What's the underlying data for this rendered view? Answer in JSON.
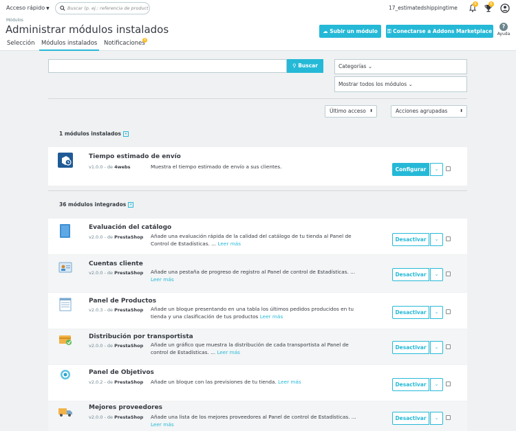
{
  "topbar": {
    "quick_access": "Acceso rápido",
    "search_placeholder": "Buscar (p. ej.: referencia de producto, no",
    "shop_name": "17_estimatedshippingtime",
    "notif_count": "6",
    "trophy_count": "6"
  },
  "header": {
    "breadcrumb": "Módulos",
    "title": "Administrar módulos instalados",
    "upload_label": "Subir un módulo",
    "addons_label": "Conectarse a Addons Marketplace",
    "help_label": "Ayuda",
    "tabs": [
      {
        "label": "Selección"
      },
      {
        "label": "Módulos instalados"
      },
      {
        "label": "Notificaciones",
        "badge": "8"
      }
    ]
  },
  "filters": {
    "search_button": "Buscar",
    "categories": "Categorías",
    "show_all": "Mostrar todos los módulos",
    "sort": "Último acceso",
    "bulk": "Acciones agrupadas"
  },
  "installed": {
    "heading": "1 módulos instalados",
    "modules": [
      {
        "name": "Tiempo estimado de envío",
        "version": "v1.0.0 - de",
        "author": "4webs",
        "desc": "Muestra el tiempo estimado de envío a sus clientes.",
        "more": "",
        "action": "Configurar"
      }
    ]
  },
  "integrated": {
    "heading": "36 módulos integrados",
    "modules": [
      {
        "name": "Evaluación del catálogo",
        "version": "v2.0.0 - de",
        "author": "PrestaShop",
        "desc": "Añade una evaluación rápida de la calidad del catálogo de tu tienda al Panel de Control de Estadísticas. ...",
        "more": "Leer más",
        "action": "Desactivar"
      },
      {
        "name": "Cuentas cliente",
        "version": "v2.0.0 - de",
        "author": "PrestaShop",
        "desc": "Añade una pestaña de progreso de registro al Panel de control de Estadísticas. ...",
        "more": "Leer más",
        "action": "Desactivar"
      },
      {
        "name": "Panel de Productos",
        "version": "v2.0.3 - de",
        "author": "PrestaShop",
        "desc": "Añade un bloque presentando en una tabla los últimos pedidos producidos en tu tienda y una clasificación de tus productos",
        "more": "Leer más",
        "action": "Desactivar"
      },
      {
        "name": "Distribución por transportista",
        "version": "v2.0.0 - de",
        "author": "PrestaShop",
        "desc": "Añade un gráfico que muestra la distribución de cada transportista al Panel de control de Estadísticas. ...",
        "more": "Leer más",
        "action": "Desactivar"
      },
      {
        "name": "Panel de Objetivos",
        "version": "v2.0.2 - de",
        "author": "PrestaShop",
        "desc": "Añade un bloque con las previsiones de tu tienda.",
        "more": "Leer más",
        "action": "Desactivar"
      },
      {
        "name": "Mejores proveedores",
        "version": "v2.0.0 - de",
        "author": "PrestaShop",
        "desc": "Añade una lista de los mejores proveedores al Panel de control de Estadísticas. ...",
        "more": "Leer más",
        "action": "Desactivar"
      }
    ]
  },
  "colors": {
    "accent": "#25b9d7",
    "badge": "#fbbb22"
  }
}
